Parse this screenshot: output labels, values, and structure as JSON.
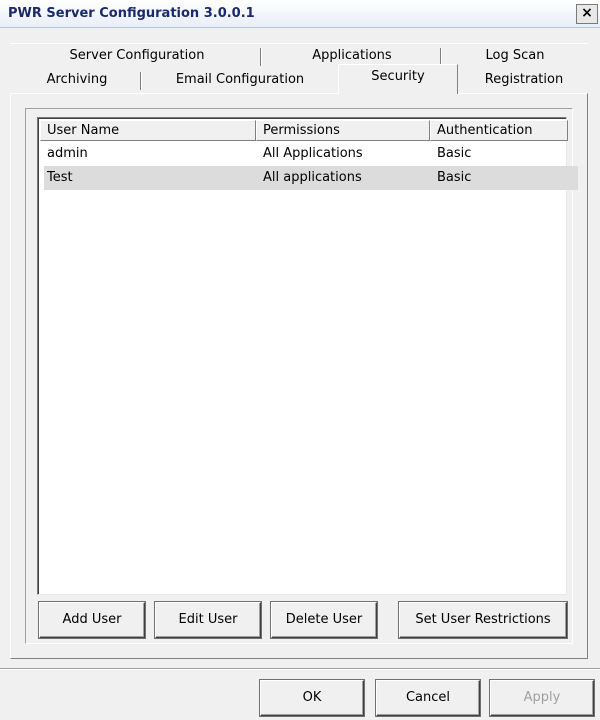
{
  "window": {
    "title": "PWR Server Configuration 3.0.0.1",
    "close_glyph": "×"
  },
  "tabs": {
    "row1": [
      {
        "label": "Server Configuration"
      },
      {
        "label": "Applications"
      },
      {
        "label": "Log Scan"
      }
    ],
    "row2": [
      {
        "label": "Archiving"
      },
      {
        "label": "Email Configuration"
      },
      {
        "label": "Security",
        "active": true
      },
      {
        "label": "Registration"
      }
    ]
  },
  "users_table": {
    "columns": [
      "User Name",
      "Permissions",
      "Authentication"
    ],
    "rows": [
      {
        "user": "admin",
        "permissions": "All Applications",
        "auth": "Basic"
      },
      {
        "user": "Test",
        "permissions": "All applications",
        "auth": "Basic",
        "selected": true
      }
    ]
  },
  "actions": {
    "add": "Add User",
    "edit": "Edit User",
    "delete": "Delete User",
    "restrictions": "Set User Restrictions"
  },
  "dialog_buttons": {
    "ok": "OK",
    "cancel": "Cancel",
    "apply": "Apply",
    "apply_disabled": true
  },
  "icons": {
    "close": "close-icon"
  },
  "colors": {
    "title_text": "#1a2a6c",
    "selected_row": "#dcdcdc",
    "face": "#f0f0f0"
  }
}
